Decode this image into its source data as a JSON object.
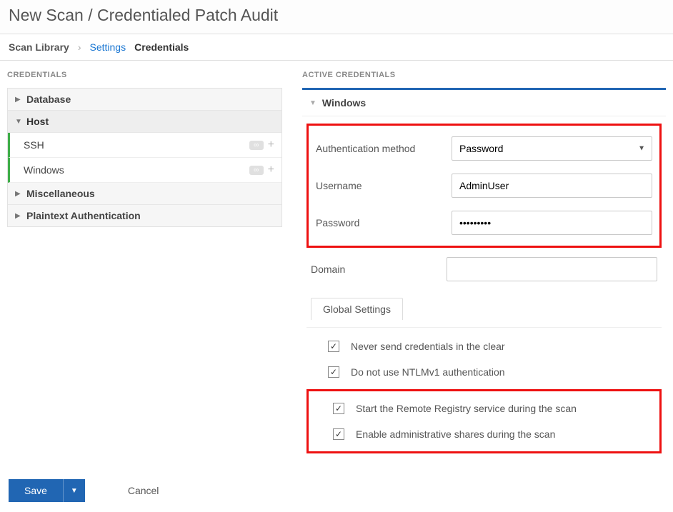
{
  "title": "New Scan / Credentialed Patch Audit",
  "breadcrumb": {
    "root": "Scan Library",
    "settings": "Settings",
    "current": "Credentials"
  },
  "left": {
    "title": "CREDENTIALS",
    "cats": [
      {
        "label": "Database",
        "expanded": false
      },
      {
        "label": "Host",
        "expanded": true
      },
      {
        "label": "Miscellaneous",
        "expanded": false
      },
      {
        "label": "Plaintext Authentication",
        "expanded": false
      }
    ],
    "host_items": [
      {
        "label": "SSH"
      },
      {
        "label": "Windows"
      }
    ]
  },
  "right": {
    "title": "ACTIVE CREDENTIALS",
    "acc": "Windows",
    "fields": {
      "auth_label": "Authentication method",
      "auth_value": "Password",
      "user_label": "Username",
      "user_value": "AdminUser",
      "pass_label": "Password",
      "pass_value": "•••••••••",
      "domain_label": "Domain",
      "domain_value": ""
    },
    "tab": "Global Settings",
    "checks": [
      "Never send credentials in the clear",
      "Do not use NTLMv1 authentication",
      "Start the Remote Registry service during the scan",
      "Enable administrative shares during the scan"
    ]
  },
  "footer": {
    "save": "Save",
    "cancel": "Cancel"
  }
}
